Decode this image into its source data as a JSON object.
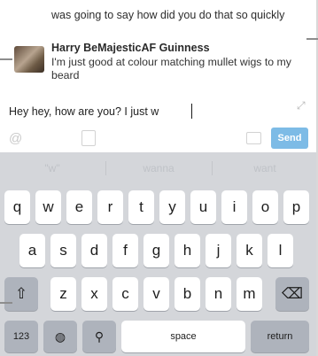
{
  "chat": {
    "previous_line": "was going to say how did you do that so quickly",
    "sender": "Harry BeMajesticAF Guinness",
    "timestamp": "",
    "message": "I'm just good at colour matching mullet wigs to my beard"
  },
  "composer": {
    "text": "Hey hey, how are you? I just w",
    "send_label": "Send"
  },
  "suggestions": [
    "\"w\"",
    "wanna",
    "want"
  ],
  "keyboard": {
    "row1": [
      "q",
      "w",
      "e",
      "r",
      "t",
      "y",
      "u",
      "i",
      "o",
      "p"
    ],
    "row2": [
      "a",
      "s",
      "d",
      "f",
      "g",
      "h",
      "j",
      "k",
      "l"
    ],
    "row3": [
      "z",
      "x",
      "c",
      "v",
      "b",
      "n",
      "m"
    ],
    "numbers_label": "123",
    "space_label": "space",
    "return_label": "return"
  },
  "icons": {
    "avatar": "avatar-photo",
    "expand": "expand-arrow-icon",
    "mention": "at-sign-icon",
    "attach": "paperclip-icon",
    "image": "image-icon",
    "shift": "shift-arrow-icon",
    "backspace": "backspace-icon",
    "globe": "globe-icon",
    "mic": "microphone-icon"
  },
  "colors": {
    "send_button": "#7dbbe6",
    "keyboard_bg": "#d4d6da",
    "key_bg": "#ffffff",
    "dark_key_bg": "#aeb3bc"
  }
}
